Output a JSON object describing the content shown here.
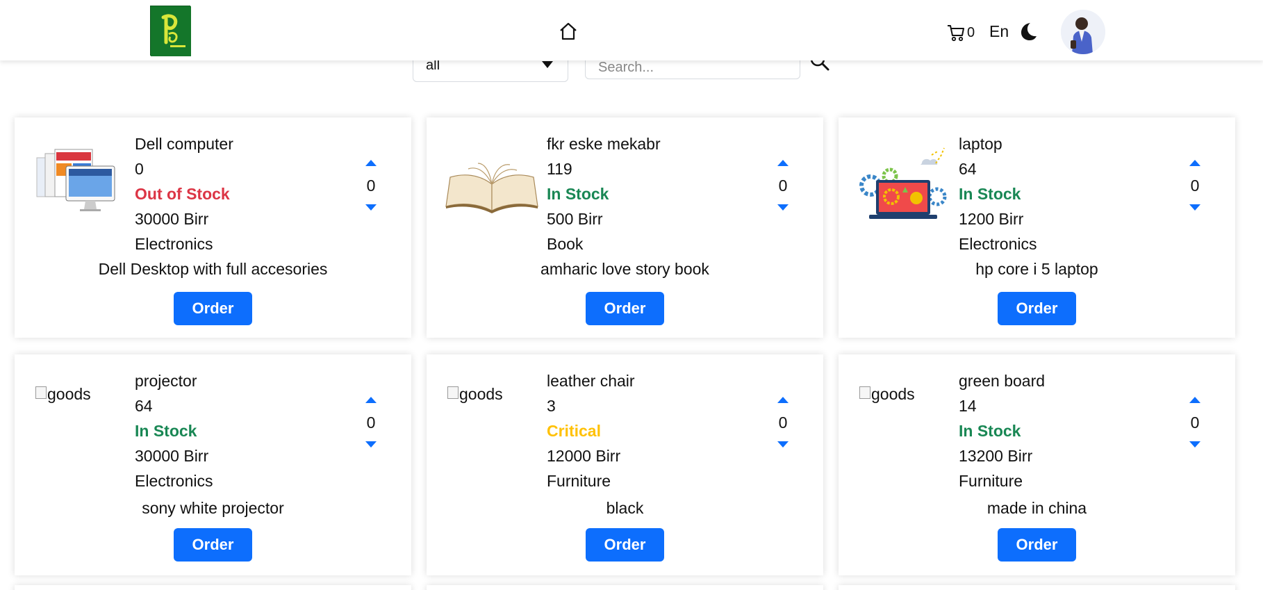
{
  "header": {
    "logo_alt": "logo",
    "cart_count": "0",
    "language": "En"
  },
  "filter": {
    "category_value": "all",
    "search_placeholder": "Search..."
  },
  "products": [
    {
      "name": "Dell computer",
      "quantity": "0",
      "status": "Out of Stock",
      "price": "30000 Birr",
      "category": "Electronics",
      "description": "Dell Desktop with full accesories",
      "order_qty": "0",
      "image": "computer-screens"
    },
    {
      "name": "fkr eske mekabr",
      "quantity": "119",
      "status": "In Stock",
      "price": "500 Birr",
      "category": "Book",
      "description": "amharic love story book",
      "order_qty": "0",
      "image": "open-book"
    },
    {
      "name": "laptop",
      "quantity": "64",
      "status": "In Stock",
      "price": "1200 Birr",
      "category": "Electronics",
      "description": "hp core i 5 laptop",
      "order_qty": "0",
      "image": "laptop-gears"
    },
    {
      "name": "projector",
      "quantity": "64",
      "status": "In Stock",
      "price": "30000 Birr",
      "category": "Electronics",
      "description": "sony white projector",
      "order_qty": "0",
      "image_alt": "goods"
    },
    {
      "name": "leather chair",
      "quantity": "3",
      "status": "Critical",
      "price": "12000 Birr",
      "category": "Furniture",
      "description": "black",
      "order_qty": "0",
      "image_alt": "goods"
    },
    {
      "name": "green board",
      "quantity": "14",
      "status": "In Stock",
      "price": "13200 Birr",
      "category": "Furniture",
      "description": "made in china",
      "order_qty": "0",
      "image_alt": "goods"
    }
  ],
  "order_label": "Order",
  "colors": {
    "primary": "#0d6efd",
    "in_stock": "#198754",
    "out_of_stock": "#dc3545",
    "critical": "#ffc107"
  }
}
